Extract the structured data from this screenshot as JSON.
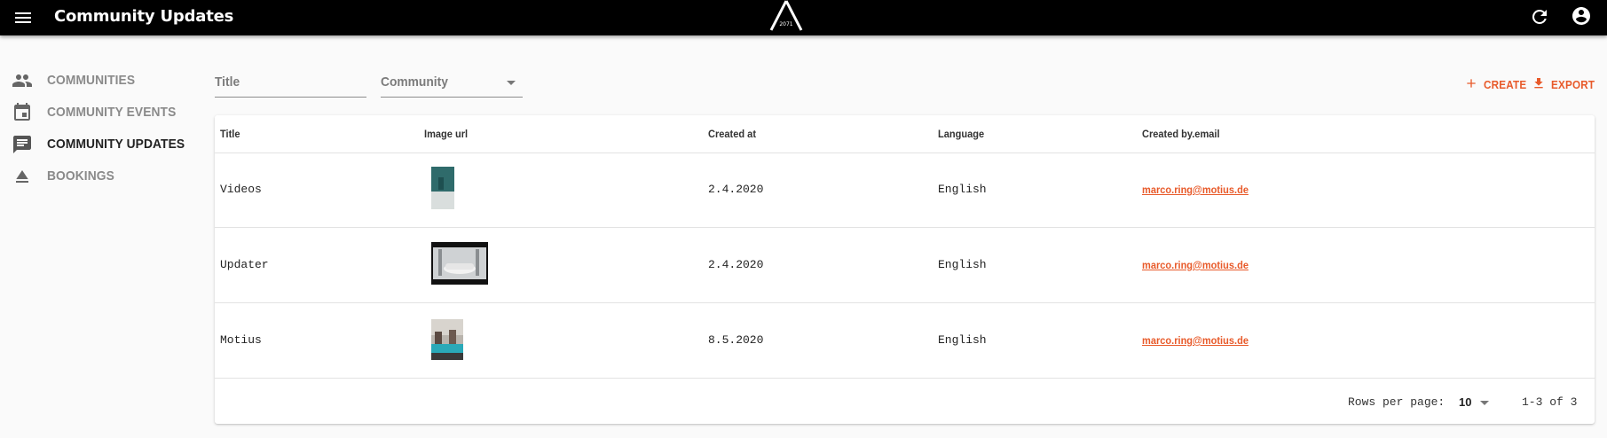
{
  "appbar": {
    "title": "Community Updates",
    "logo_text": "2071",
    "icons": {
      "menu": "menu-icon",
      "refresh": "refresh-icon",
      "account": "account-circle-icon"
    }
  },
  "sidebar": {
    "items": [
      {
        "label": "COMMUNITIES",
        "icon": "people-icon",
        "active": false
      },
      {
        "label": "COMMUNITY EVENTS",
        "icon": "calendar-icon",
        "active": false
      },
      {
        "label": "COMMUNITY UPDATES",
        "icon": "comment-icon",
        "active": true
      },
      {
        "label": "BOOKINGS",
        "icon": "eject-icon",
        "active": false
      }
    ]
  },
  "filters": {
    "title_placeholder": "Title",
    "community_placeholder": "Community"
  },
  "actions": {
    "create_label": "CREATE",
    "export_label": "EXPORT"
  },
  "table": {
    "columns": [
      "Title",
      "Image url",
      "Created at",
      "Language",
      "Created by.email"
    ],
    "rows": [
      {
        "title": "Videos",
        "created_at": "2.4.2020",
        "language": "English",
        "email": "marco.ring@motius.de"
      },
      {
        "title": "Updater",
        "created_at": "2.4.2020",
        "language": "English",
        "email": "marco.ring@motius.de"
      },
      {
        "title": "Motius",
        "created_at": "8.5.2020",
        "language": "English",
        "email": "marco.ring@motius.de"
      }
    ]
  },
  "pagination": {
    "rows_per_page_label": "Rows per page:",
    "rows_per_page_value": "10",
    "range_label": "1-3 of 3"
  },
  "colors": {
    "accent": "#e85a2a",
    "appbar": "#000000",
    "background": "#fafafa"
  }
}
